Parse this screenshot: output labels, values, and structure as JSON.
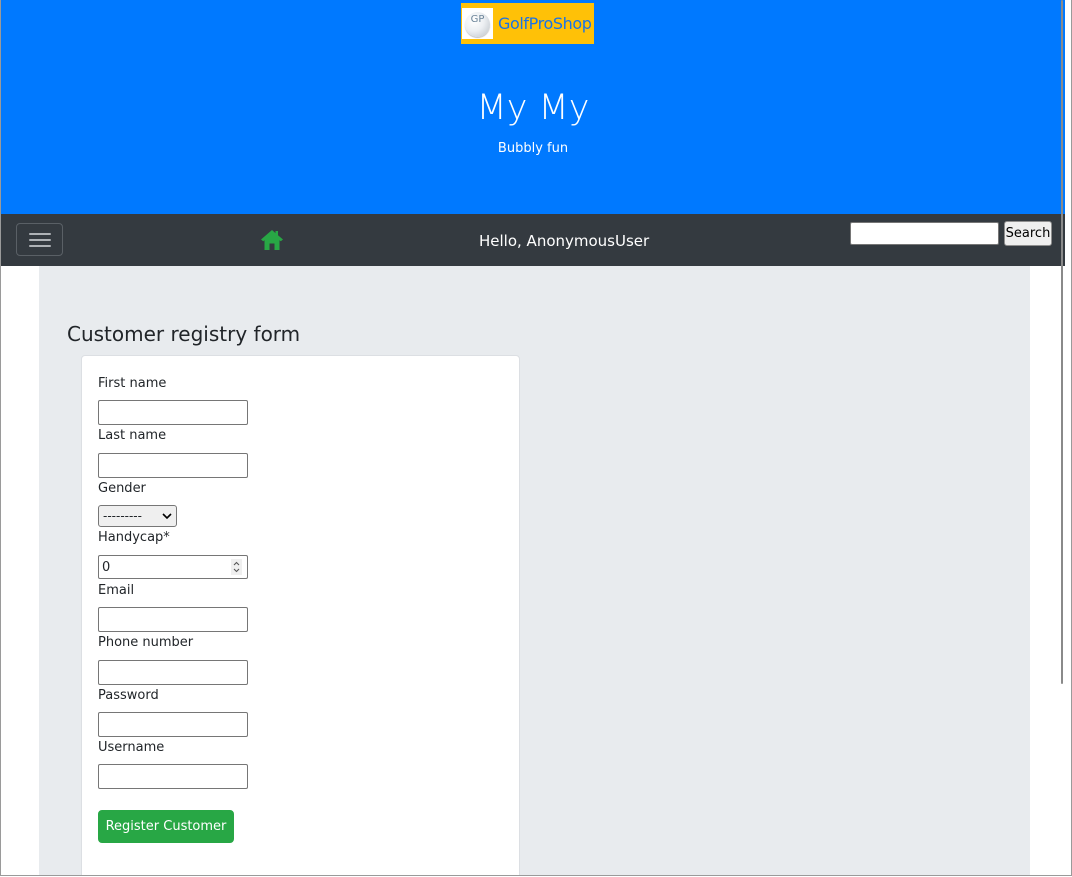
{
  "brand": {
    "logo_text": "GP",
    "name": "GolfProShop"
  },
  "header": {
    "title": "My My",
    "subtitle": "Bubbly fun"
  },
  "navbar": {
    "greeting": "Hello, AnonymousUser",
    "search": {
      "value": "",
      "placeholder": "",
      "button_label": "Search"
    }
  },
  "form": {
    "title": "Customer registry form",
    "fields": {
      "first_name": {
        "label": "First name",
        "value": ""
      },
      "last_name": {
        "label": "Last name",
        "value": ""
      },
      "gender": {
        "label": "Gender",
        "selected": "---------"
      },
      "handycap": {
        "label": "Handycap*",
        "value": "0"
      },
      "email": {
        "label": "Email",
        "value": ""
      },
      "phone": {
        "label": "Phone number",
        "value": ""
      },
      "password": {
        "label": "Password",
        "value": ""
      },
      "username": {
        "label": "Username",
        "value": ""
      }
    },
    "submit_label": "Register Customer"
  },
  "icons": {
    "home": "home-icon",
    "menu": "hamburger-menu-icon",
    "select_arrow": "chevron-down-icon",
    "spinner": "number-spinner-icon"
  },
  "colors": {
    "header_bg": "#0079ff",
    "brand_bg": "#ffc107",
    "navbar_bg": "#343a40",
    "home_icon": "#28a745",
    "content_bg": "#e8ebee",
    "submit_bg": "#28a745"
  }
}
